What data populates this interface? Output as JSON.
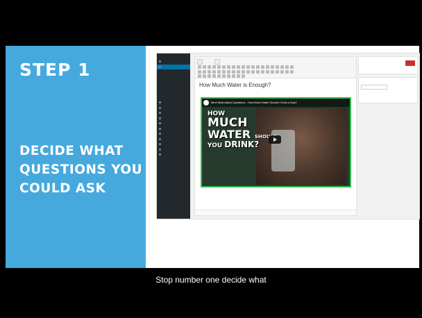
{
  "slide": {
    "step_title": "STEP 1",
    "step_desc_lines": [
      "DECIDE WHAT",
      "QUESTIONS YOU",
      "COULD ASK"
    ]
  },
  "caption": "Stop number one decide what",
  "colors": {
    "panel": "#46a9de",
    "video_border": "#34c04a"
  },
  "wp": {
    "post_title": "How Much Water is Enough?",
    "video": {
      "channel_title": "Mind Most Asked Questions · How Much Water Should I Drink a Day?",
      "headline_lines": [
        "HOW",
        "MUCH",
        "WATER",
        "SHOULD",
        "YOU",
        "DRINK?"
      ]
    }
  }
}
